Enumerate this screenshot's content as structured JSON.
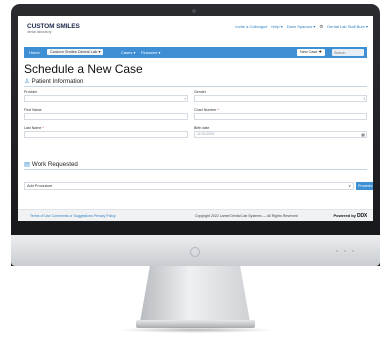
{
  "brand": {
    "name": "CUSTOM SMILES",
    "subtitle": "dental laboratory"
  },
  "top_links": {
    "invite": "Invite a Colleague",
    "help": "Help ▾",
    "user": "Dave Sparrow ▾",
    "gear": "⚙",
    "lab": "Dental Lab Stall Bum ▾"
  },
  "nav": {
    "home": "Home",
    "lab_selector": "Custom Smiles Dental Lab ▾",
    "cases": "Cases ▾",
    "finances": "Finances ▾",
    "new_case": "New Case ✚",
    "search_placeholder": "Search"
  },
  "page": {
    "title": "Schedule a New Case"
  },
  "patient_info": {
    "heading": "Patient Information",
    "icon": "person-icon",
    "provider_label": "Provider",
    "gender_label": "Gender",
    "first_name_label": "First Name",
    "chart_number_label": "Chart Number",
    "last_name_label": "Last Name",
    "birth_date_label": "Birth date",
    "birth_date_placeholder": "11/01/2000",
    "required_mark": "*",
    "select_arrow": "↕",
    "calendar_glyph": "▦"
  },
  "work_requested": {
    "heading": "Work Requested",
    "icon": "clipboard-icon",
    "add_procedure": "Add Procedure",
    "dropdown_arrow": "∨",
    "procedures_button": "Procedures ▾"
  },
  "footer": {
    "links": "Terms of Use   Comments or Suggestions   Privacy Policy",
    "copyright": "Copyright 2022 Lamet Dental Lab Systems — All Rights Reserved",
    "powered_by": "Powered by",
    "powered_brand": "DDX"
  },
  "colors": {
    "accent": "#3e8fd4",
    "brand_dark": "#1c2a4a"
  }
}
